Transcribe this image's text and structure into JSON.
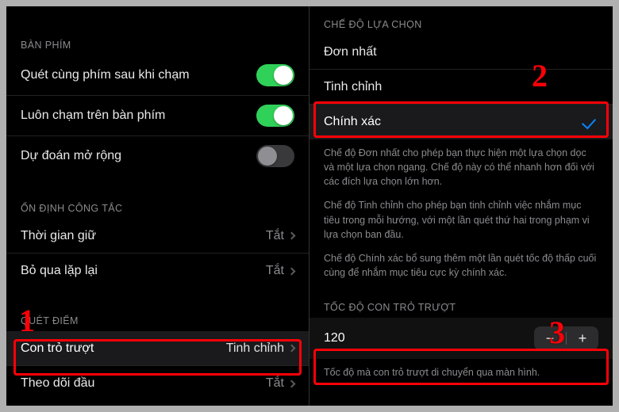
{
  "left": {
    "sec_keyboard": "BÀN PHÍM",
    "row_scan_after_tap": "Quét cùng phím sau khi chạm",
    "row_always_tap": "Luôn chạm trên bàn phím",
    "row_extended_predict": "Dự đoán mở rộng",
    "sec_switch_stab": "ỔN ĐỊNH CÔNG TẮC",
    "row_hold_duration": "Thời gian giữ",
    "row_ignore_repeat": "Bỏ qua lặp lại",
    "val_off": "Tắt",
    "sec_point_scan": "QUÉT ĐIỂM",
    "row_gliding_cursor": "Con trỏ trượt",
    "val_refine": "Tinh chỉnh",
    "row_head_track": "Theo dõi đầu"
  },
  "right": {
    "sec_selection_mode": "CHẾ ĐỘ LỰA CHỌN",
    "row_single": "Đơn nhất",
    "row_refine": "Tinh chỉnh",
    "row_precise": "Chính xác",
    "desc_single": "Chế độ Đơn nhất cho phép bạn thực hiện một lựa chọn dọc và một lựa chọn ngang. Chế độ này có thể nhanh hơn đối với các đích lựa chọn lớn hơn.",
    "desc_refine": "Chế độ Tinh chỉnh cho phép bạn tinh chỉnh việc nhắm mục tiêu trong mỗi hướng, với một lần quét thứ hai trong phạm vi lựa chọn ban đầu.",
    "desc_precise": "Chế độ Chính xác bổ sung thêm một lần quét tốc độ thấp cuối cùng để nhắm mục tiêu cực kỳ chính xác.",
    "sec_speed": "TỐC ĐỘ CON TRỎ TRƯỢT",
    "speed_value": "120",
    "desc_speed": "Tốc độ mà con trỏ trượt di chuyển qua màn hình.",
    "minus": "−",
    "plus": "+"
  },
  "marks": {
    "m1": "1",
    "m2": "2",
    "m3": "3"
  }
}
